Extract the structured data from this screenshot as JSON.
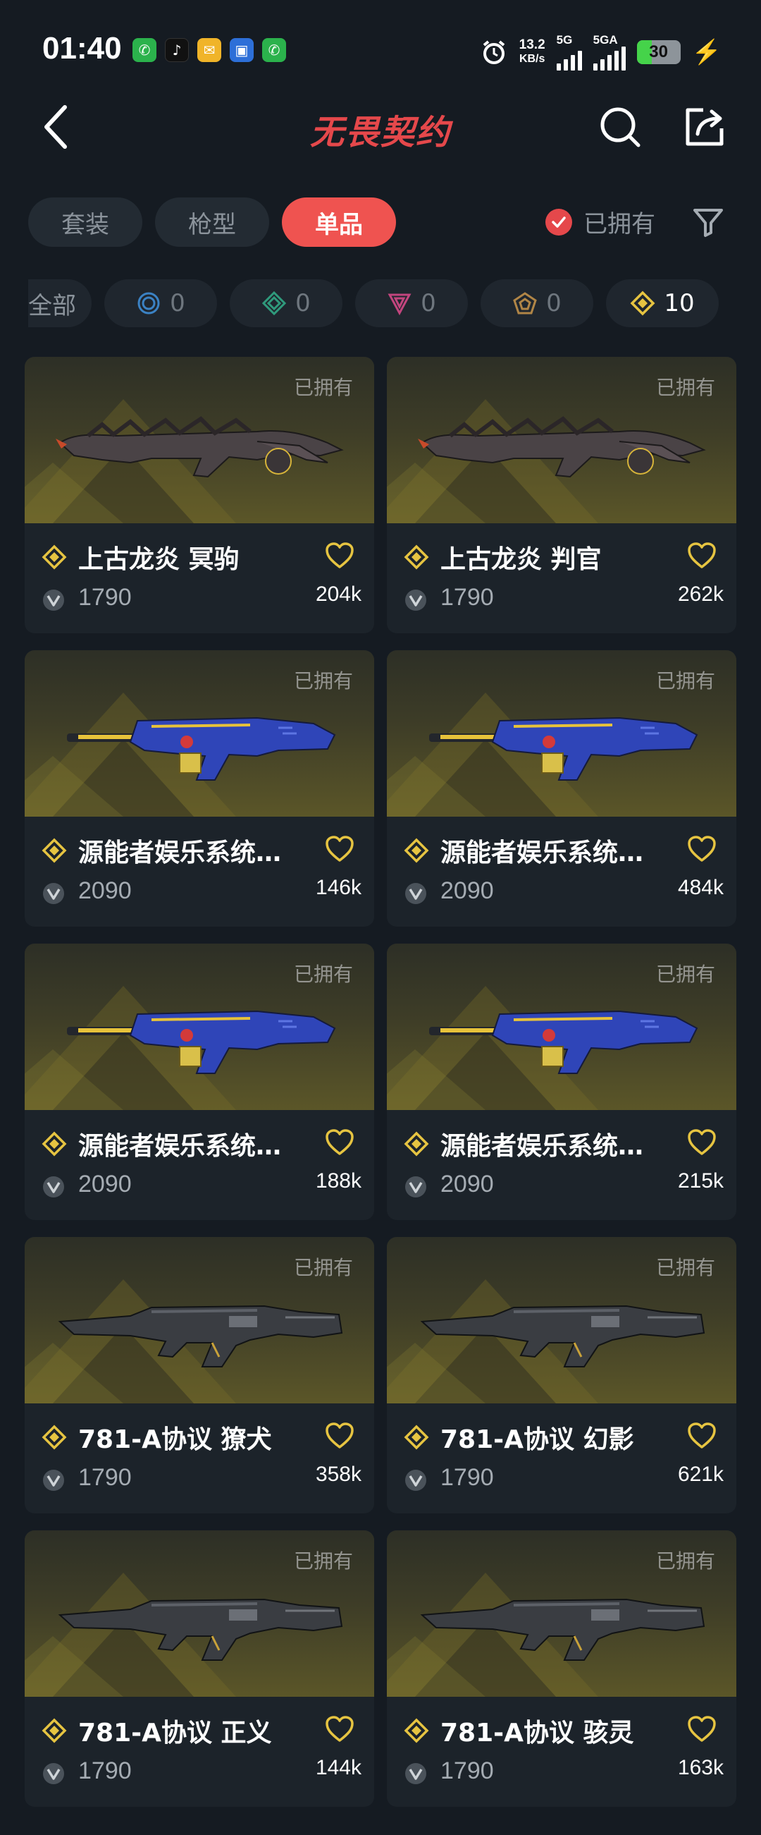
{
  "status": {
    "time": "01:40",
    "speed_top": "13.2",
    "speed_unit": "KB/s",
    "net1": "5G",
    "net2": "5GA",
    "battery": "30"
  },
  "header": {
    "title": "无畏契约"
  },
  "tabs": [
    {
      "label": "套装",
      "active": false
    },
    {
      "label": "枪型",
      "active": false
    },
    {
      "label": "单品",
      "active": true
    }
  ],
  "owned_filter": {
    "label": "已拥有",
    "checked": true
  },
  "rarity": [
    {
      "label": "全部",
      "icon": ""
    },
    {
      "count": "0",
      "icon": "circle-tier-icon",
      "color": "#3b82c4"
    },
    {
      "count": "0",
      "icon": "diamond-tier-icon",
      "color": "#2f9a7c"
    },
    {
      "count": "0",
      "icon": "triangle-tier-icon",
      "color": "#c2457e"
    },
    {
      "count": "0",
      "icon": "pentagon-tier-icon",
      "color": "#b08546"
    },
    {
      "count": "10",
      "icon": "premium-diamond-icon",
      "color": "#e6c441"
    }
  ],
  "items": [
    {
      "name": "上古龙炎 冥驹",
      "price": "1790",
      "likes": "204k",
      "owned": "已拥有",
      "style": "dragon"
    },
    {
      "name": "上古龙炎 判官",
      "price": "1790",
      "likes": "262k",
      "owned": "已拥有",
      "style": "dragon"
    },
    {
      "name": "源能者娱乐系统…",
      "price": "2090",
      "likes": "146k",
      "owned": "已拥有",
      "style": "blue"
    },
    {
      "name": "源能者娱乐系统…",
      "price": "2090",
      "likes": "484k",
      "owned": "已拥有",
      "style": "blue"
    },
    {
      "name": "源能者娱乐系统…",
      "price": "2090",
      "likes": "188k",
      "owned": "已拥有",
      "style": "blue"
    },
    {
      "name": "源能者娱乐系统…",
      "price": "2090",
      "likes": "215k",
      "owned": "已拥有",
      "style": "blue"
    },
    {
      "name": "781-A协议 獠犬",
      "price": "1790",
      "likes": "358k",
      "owned": "已拥有",
      "style": "black"
    },
    {
      "name": "781-A协议 幻影",
      "price": "1790",
      "likes": "621k",
      "owned": "已拥有",
      "style": "black"
    },
    {
      "name": "781-A协议 正义",
      "price": "1790",
      "likes": "144k",
      "owned": "已拥有",
      "style": "black"
    },
    {
      "name": "781-A协议 骇灵",
      "price": "1790",
      "likes": "163k",
      "owned": "已拥有",
      "style": "black"
    }
  ],
  "colors": {
    "accent": "#ef5350",
    "tier_gold": "#e6c441",
    "bg": "#151b22"
  }
}
